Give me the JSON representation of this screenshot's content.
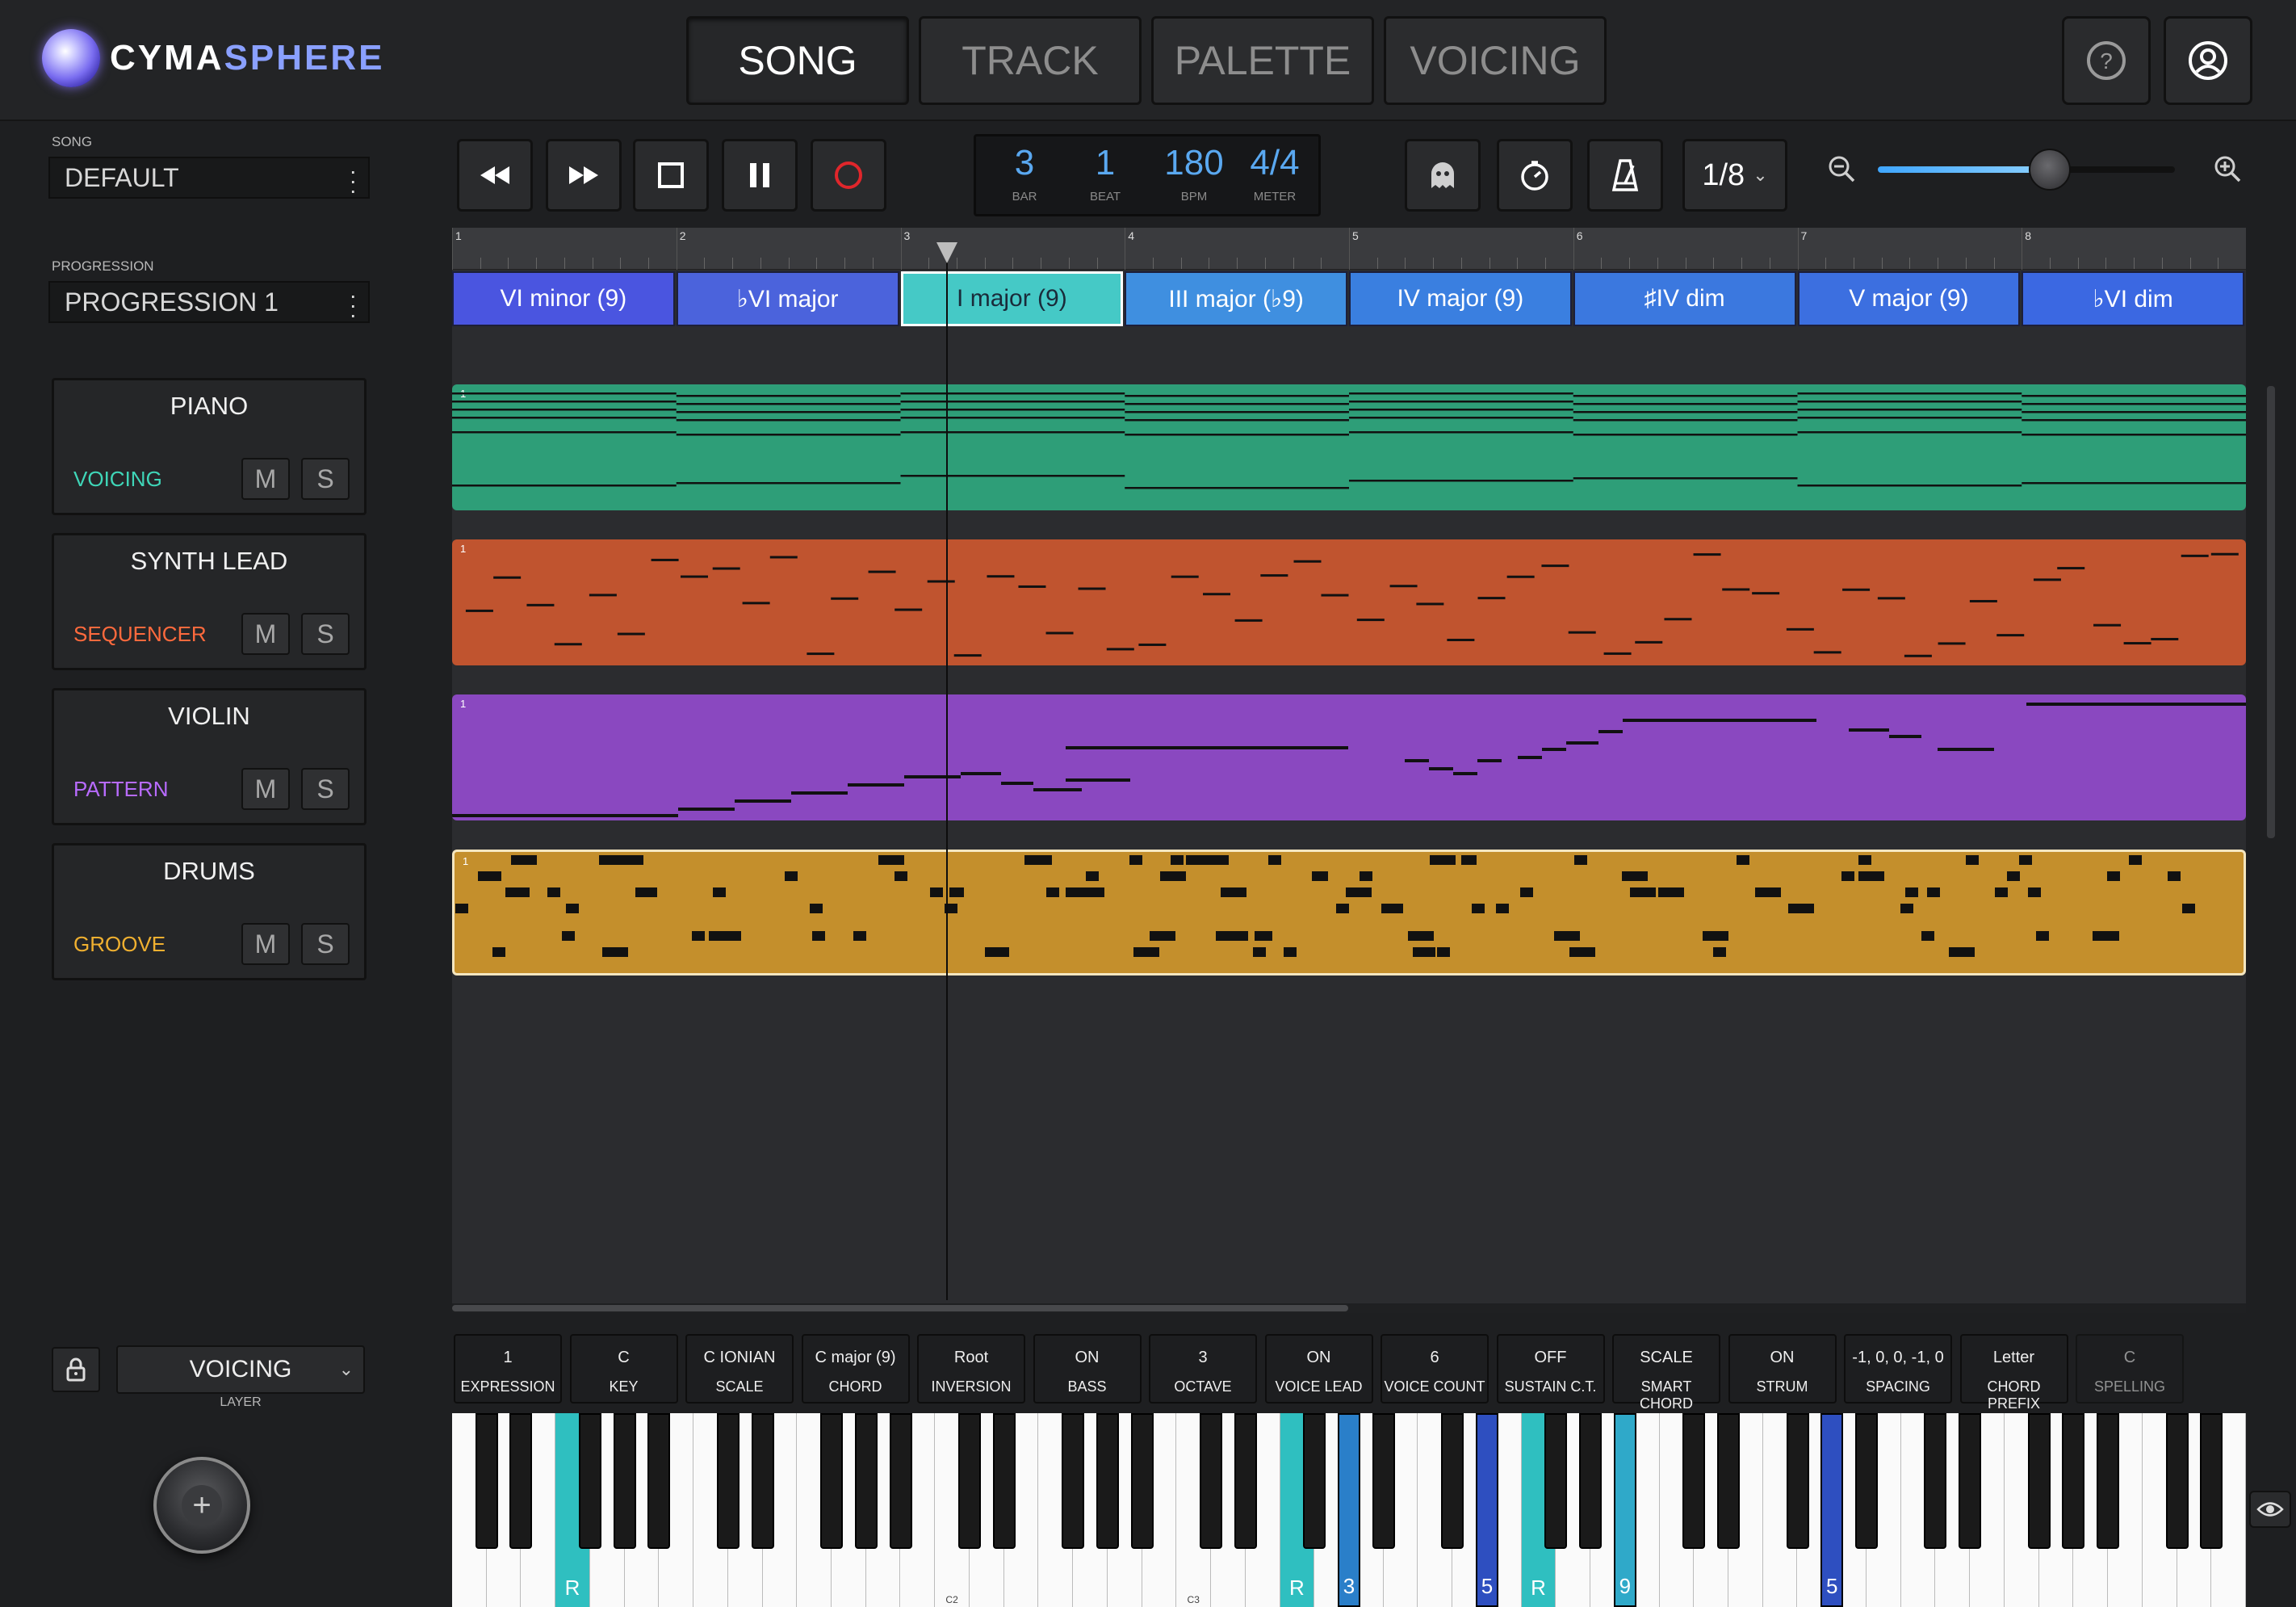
{
  "app": {
    "logo_prefix": "CYMA",
    "logo_suffix": "SPHERE",
    "tabs": [
      "SONG",
      "TRACK",
      "PALETTE",
      "VOICING"
    ],
    "active_tab": "SONG"
  },
  "left": {
    "song_label": "SONG",
    "song_value": "DEFAULT",
    "progression_label": "PROGRESSION",
    "progression_value": "PROGRESSION 1",
    "tracks": [
      {
        "name": "PIANO",
        "mode": "VOICING",
        "mode_color": "#3fd6b8"
      },
      {
        "name": "SYNTH LEAD",
        "mode": "SEQUENCER",
        "mode_color": "#ff6a3d"
      },
      {
        "name": "VIOLIN",
        "mode": "PATTERN",
        "mode_color": "#b86bff"
      },
      {
        "name": "DRUMS",
        "mode": "GROOVE",
        "mode_color": "#f0b030"
      }
    ],
    "mute_label": "M",
    "solo_label": "S",
    "layer_value": "VOICING",
    "layer_label": "LAYER"
  },
  "transport": {
    "bar": "3",
    "bar_label": "BAR",
    "beat": "1",
    "beat_label": "BEAT",
    "bpm": "180",
    "bpm_label": "BPM",
    "meter": "4/4",
    "meter_label": "METER",
    "grid": "1/8",
    "zoom_fraction": 0.58
  },
  "ruler": [
    "1",
    "2",
    "3",
    "4",
    "5",
    "6",
    "7",
    "8"
  ],
  "chords": [
    {
      "label": "VI minor (9)",
      "color": "#4a55e0"
    },
    {
      "label": "♭VI major",
      "color": "#4b63dc"
    },
    {
      "label": "I major (9)",
      "color": "#45c9c6",
      "selected": true
    },
    {
      "label": "III major (♭9)",
      "color": "#3f8fe0"
    },
    {
      "label": "IV major (9)",
      "color": "#3a7fe0"
    },
    {
      "label": "♯IV dim",
      "color": "#3b78df"
    },
    {
      "label": "V major (9)",
      "color": "#3c6fe0"
    },
    {
      "label": "♭VI dim",
      "color": "#3b68e2"
    }
  ],
  "lanes": [
    {
      "name": "piano",
      "color": "#2e9e78",
      "number": "1"
    },
    {
      "name": "synth",
      "color": "#c0542f",
      "number": "1"
    },
    {
      "name": "violin",
      "color": "#8a48c0",
      "number": "1"
    },
    {
      "name": "drums",
      "color": "#c48f2c",
      "number": "1"
    }
  ],
  "params": [
    {
      "value": "1",
      "label": "EXPRESSION"
    },
    {
      "value": "C",
      "label": "KEY"
    },
    {
      "value": "C IONIAN",
      "label": "SCALE"
    },
    {
      "value": "C major (9)",
      "label": "CHORD"
    },
    {
      "value": "Root",
      "label": "INVERSION"
    },
    {
      "value": "ON",
      "label": "BASS"
    },
    {
      "value": "3",
      "label": "OCTAVE"
    },
    {
      "value": "ON",
      "label": "VOICE LEAD"
    },
    {
      "value": "6",
      "label": "VOICE COUNT"
    },
    {
      "value": "OFF",
      "label": "SUSTAIN C.T."
    },
    {
      "value": "SCALE",
      "label": "SMART CHORD"
    },
    {
      "value": "ON",
      "label": "STRUM"
    },
    {
      "value": "-1, 0, 0, -1, 0",
      "label": "SPACING"
    },
    {
      "value": "Letter",
      "label": "CHORD PREFIX"
    },
    {
      "value": "C",
      "label": "SPELLING"
    }
  ],
  "keyboard": {
    "octave_labels": [
      "C2",
      "C3"
    ],
    "highlighted": [
      {
        "label": "R",
        "color": "#2fbfc0"
      },
      {
        "label": "3",
        "color": "#2a7fc9"
      },
      {
        "label": "5",
        "color": "#2e4fc0"
      },
      {
        "label": "R",
        "color": "#2fbfc0"
      },
      {
        "label": "9",
        "color": "#2fa9c9"
      },
      {
        "label": "5",
        "color": "#2e4fc0"
      },
      {
        "label": "R",
        "color": "#2fbfc0"
      }
    ]
  }
}
